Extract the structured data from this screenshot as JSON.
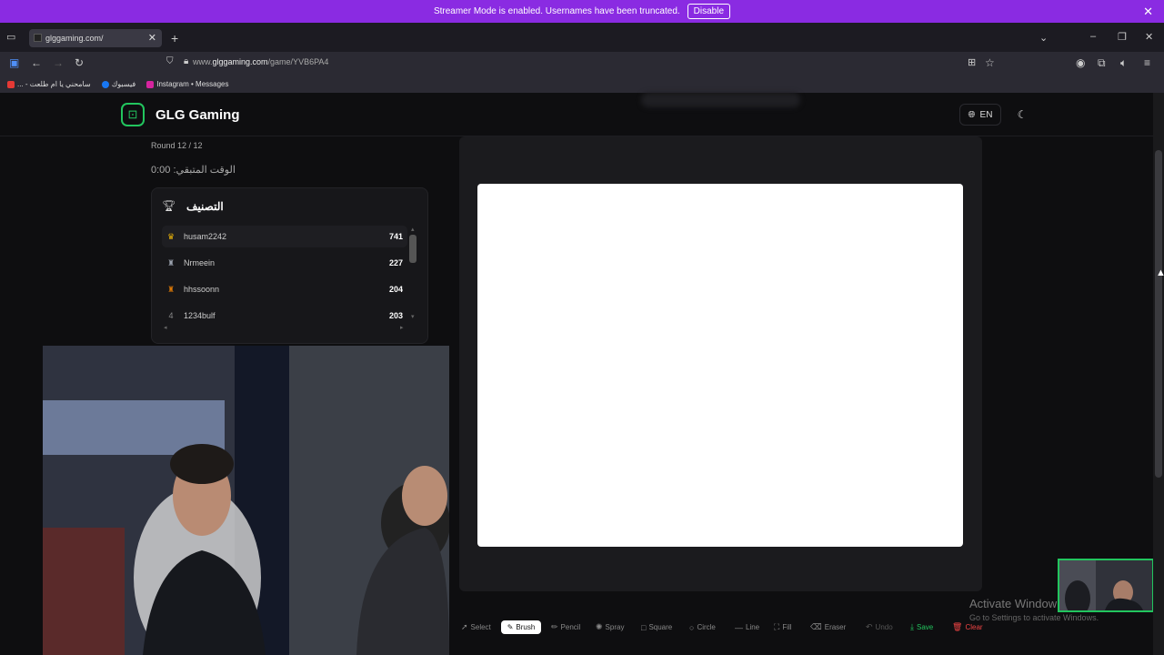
{
  "banner": {
    "text": "Streamer Mode is enabled. Usernames have been truncated.",
    "disable_label": "Disable"
  },
  "browser": {
    "tab_title": "glggaming.com/",
    "url_prefix": "www.",
    "url_domain": "glggaming.com",
    "url_path": "/game/YVB6PA4",
    "bookmarks": [
      {
        "label": "... - سامحني يا ام طلعت",
        "color": "#e53935"
      },
      {
        "label": "فيسبوك",
        "color": "#1877f2"
      },
      {
        "label": "Instagram • Messages",
        "color": "#d6249f"
      }
    ]
  },
  "site": {
    "brand": "GLG Gaming",
    "lang": "EN"
  },
  "game": {
    "round": "Round 12 / 12",
    "timer": "الوقت المتبقي: 0:00",
    "ranking_title": "التصنيف",
    "players": [
      {
        "rank_icon": "♛",
        "rank_color": "#eab308",
        "name": "husam2242",
        "score": "741"
      },
      {
        "rank_icon": "♜",
        "rank_color": "#9ca3af",
        "name": "Nrmeein",
        "score": "227"
      },
      {
        "rank_icon": "♜",
        "rank_color": "#d97706",
        "name": "hhssoonn",
        "score": "204"
      },
      {
        "rank_icon": "4",
        "rank_color": "#888888",
        "name": "1234bulf",
        "score": "203"
      }
    ]
  },
  "tools": [
    {
      "label": "Select",
      "glyph": "➚"
    },
    {
      "label": "Brush",
      "glyph": "✎"
    },
    {
      "label": "Pencil",
      "glyph": "✏"
    },
    {
      "label": "Spray",
      "glyph": "✺"
    },
    {
      "label": "Square",
      "glyph": "□"
    },
    {
      "label": "Circle",
      "glyph": "○"
    },
    {
      "label": "Line",
      "glyph": "—"
    },
    {
      "label": "Fill",
      "glyph": "⛶"
    },
    {
      "label": "Eraser",
      "glyph": "⌫"
    },
    {
      "label": "Undo",
      "glyph": "↶"
    },
    {
      "label": "Save",
      "glyph": "⤓",
      "color": "#22c55e"
    },
    {
      "label": "Clear",
      "glyph": "🗑",
      "color": "#ef4444"
    }
  ],
  "windows": {
    "line1": "Activate Window",
    "line2": "Go to Settings to activate Windows."
  }
}
